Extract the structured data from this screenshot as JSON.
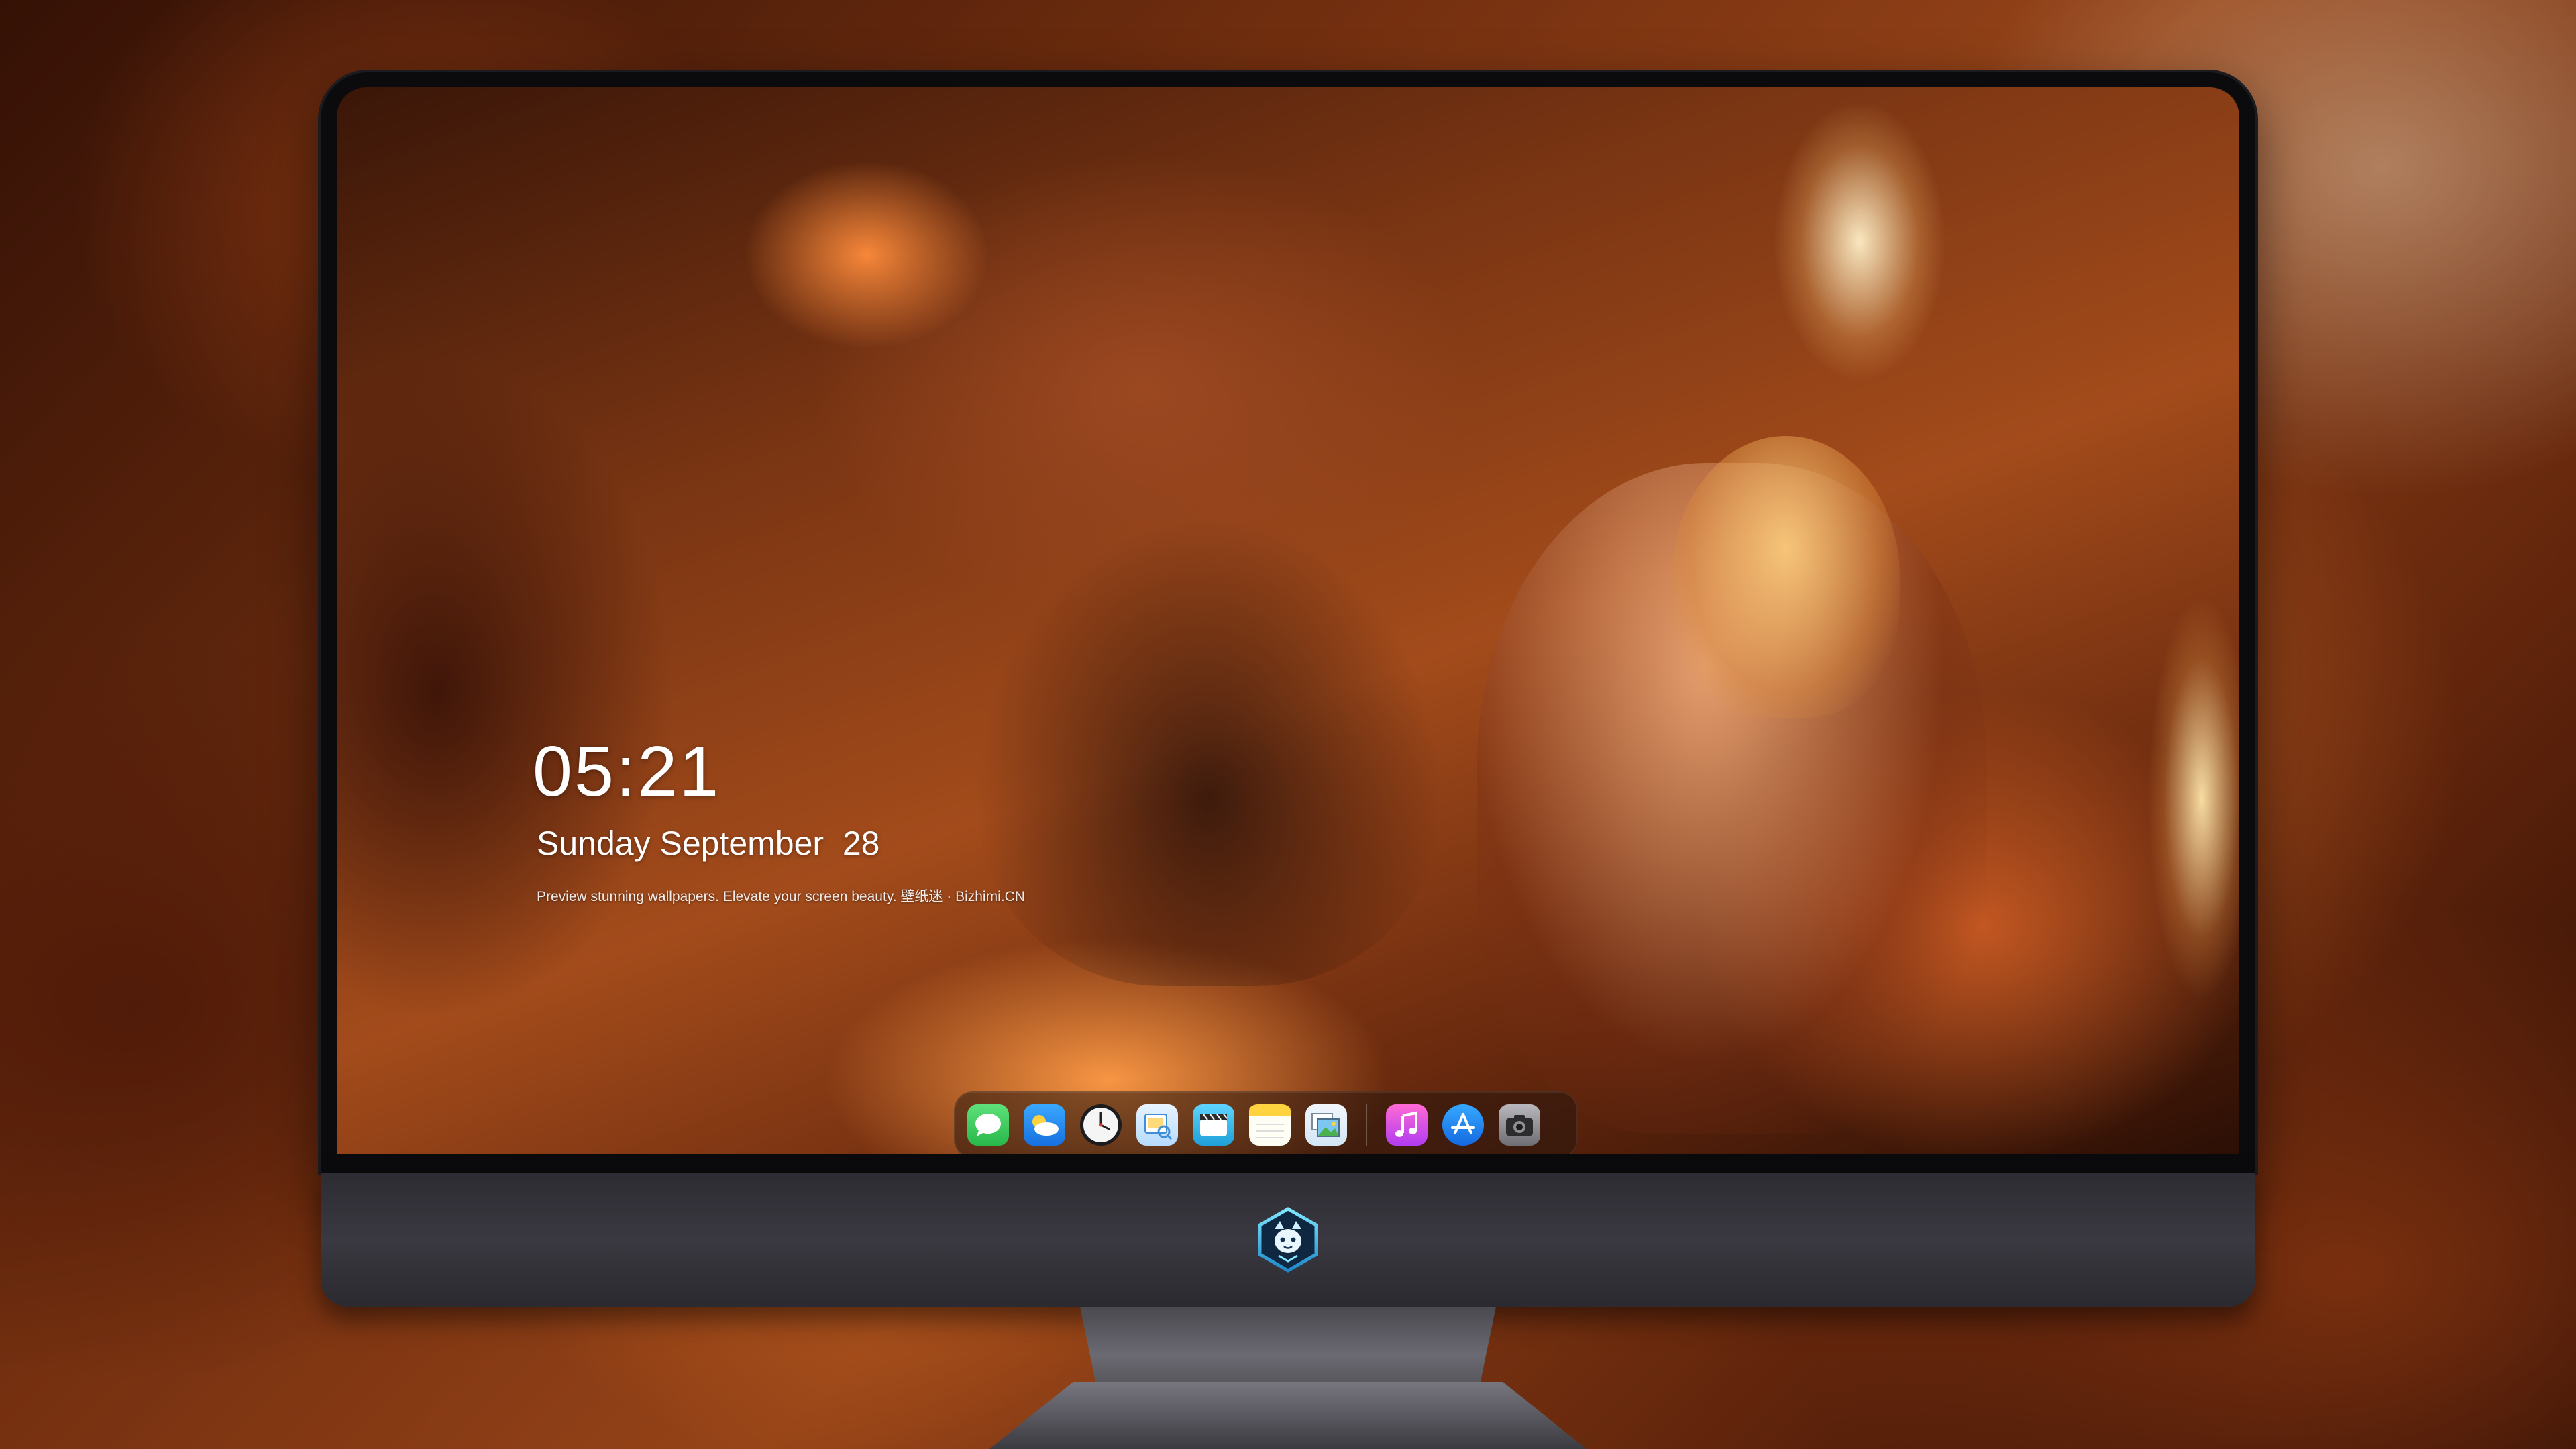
{
  "lock_screen": {
    "time": "05:21",
    "date": "Sunday September  28",
    "tagline": "Preview stunning wallpapers. Elevate your screen beauty. 壁纸迷 · Bizhimi.CN"
  },
  "dock": {
    "apps": [
      {
        "name": "messages-icon",
        "color": "#34c759"
      },
      {
        "name": "weather-icon",
        "color": "#1e8ef5"
      },
      {
        "name": "clock-icon",
        "color": "#f2f2f2"
      },
      {
        "name": "preview-icon",
        "color": "#7ac8ff"
      },
      {
        "name": "clips-icon",
        "color": "#3db4e8"
      },
      {
        "name": "notes-icon",
        "color": "#ffd23f"
      },
      {
        "name": "photo-viewer-icon",
        "color": "#58b4e8"
      },
      {
        "name": "music-icon",
        "color": "#e948c8"
      },
      {
        "name": "app-store-icon",
        "color": "#1b8cf5"
      },
      {
        "name": "camera-icon",
        "color": "#8e8e93"
      }
    ]
  },
  "colors": {
    "bezel": "#0b0b0d",
    "chin": "#35333a",
    "accent_glow": "#ff9a44"
  }
}
